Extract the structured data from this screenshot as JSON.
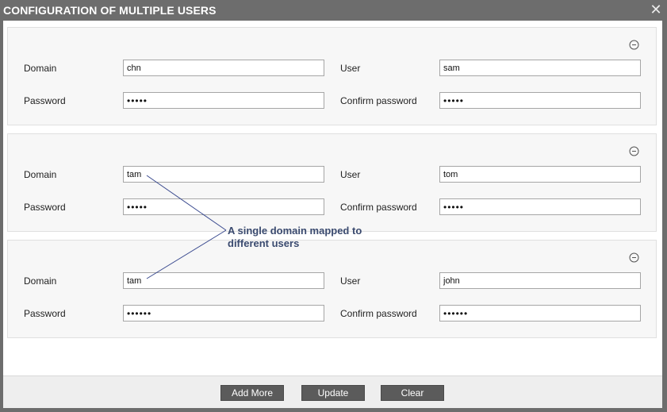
{
  "dialog": {
    "title": "CONFIGURATION OF MULTIPLE USERS",
    "close_icon": "close-icon"
  },
  "labels": {
    "domain": "Domain",
    "user": "User",
    "password": "Password",
    "confirm_password": "Confirm password"
  },
  "entries": [
    {
      "domain": "chn",
      "user": "sam",
      "password": "•••••",
      "confirm_password": "•••••"
    },
    {
      "domain": "tam",
      "user": "tom",
      "password": "•••••",
      "confirm_password": "•••••"
    },
    {
      "domain": "tam",
      "user": "john",
      "password": "••••••",
      "confirm_password": "••••••"
    }
  ],
  "annotation": {
    "text": "A single domain mapped to different users",
    "color": "#3a4a6f"
  },
  "buttons": {
    "add_more": "Add More",
    "update": "Update",
    "clear": "Clear"
  }
}
